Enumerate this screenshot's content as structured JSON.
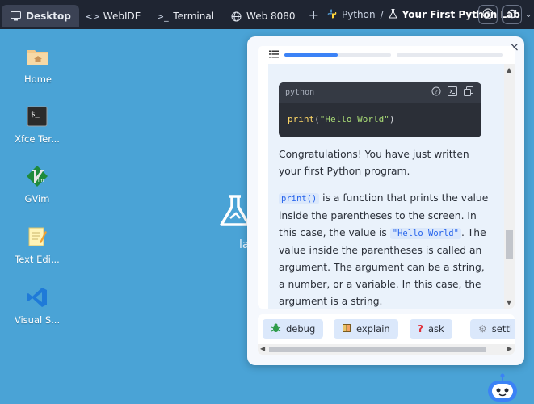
{
  "topbar": {
    "tabs": [
      {
        "label": "Desktop",
        "icon": "monitor-icon",
        "active": true
      },
      {
        "label": "WebIDE",
        "icon": "code-icon",
        "active": false
      },
      {
        "label": "Terminal",
        "icon": "terminal-icon",
        "active": false
      },
      {
        "label": "Web 8080",
        "icon": "globe-icon",
        "active": false
      }
    ],
    "add_symbol": "+",
    "breadcrumb": {
      "course": "Python",
      "separator": "/",
      "lab": "Your First Python Lab"
    }
  },
  "desktop_icons": [
    {
      "label": "Home",
      "icon": "home-folder-icon"
    },
    {
      "label": "Xfce Ter...",
      "icon": "terminal-app-icon"
    },
    {
      "label": "GVim",
      "icon": "gvim-icon"
    },
    {
      "label": "Text Edi...",
      "icon": "text-editor-icon"
    },
    {
      "label": "Visual S...",
      "icon": "vscode-icon"
    }
  ],
  "center_text": "la",
  "panel": {
    "close_symbol": "×",
    "progress_segments": [
      0.5,
      0.0
    ],
    "code": {
      "language": "python",
      "fn": "print",
      "open": "(",
      "str": "\"Hello World\"",
      "close": ")"
    },
    "congrats": "Congratulations! You have just written your first Python program.",
    "explanation": {
      "code1": "print()",
      "text1": " is a function that prints the value inside the parentheses to the screen. In this case, the value is ",
      "code2": "\"Hello World\"",
      "text2": ". The value inside the parentheses is called an argument. The argument can be a string, a number, or a variable. In this case, the argument is a string."
    }
  },
  "toolbar": {
    "buttons": [
      {
        "label": "debug",
        "icon": "bug-icon"
      },
      {
        "label": "explain",
        "icon": "book-icon"
      },
      {
        "label": "ask",
        "icon": "question-mark-icon"
      },
      {
        "label": "setti",
        "icon": "gear-icon"
      }
    ]
  },
  "colors": {
    "desktop_bg": "#4aa3d6",
    "topbar_bg": "#1f2532",
    "accent": "#3b82f6"
  }
}
